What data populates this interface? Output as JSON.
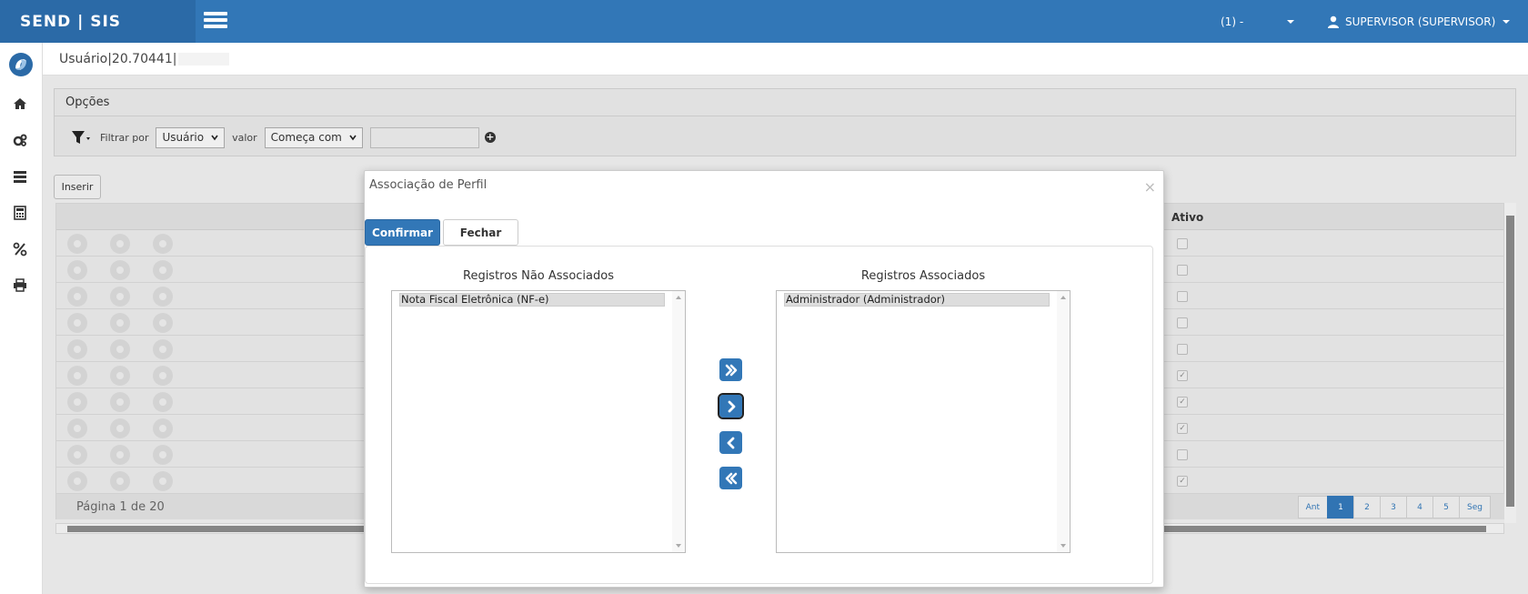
{
  "header": {
    "brand": "SEND | SIS",
    "context": "(1) -",
    "user": "SUPERVISOR (SUPERVISOR)"
  },
  "breadcrumb": {
    "text": "Usuário|20.70441|"
  },
  "options": {
    "title": "Opções",
    "filter_label": "Filtrar por",
    "filter_field": "Usuário",
    "value_label": "valor",
    "value_op": "Começa com",
    "value_input": ""
  },
  "toolbar": {
    "insert_label": "Inserir"
  },
  "grid": {
    "active_header": "Ativo",
    "rows": [
      {
        "active": false
      },
      {
        "active": false
      },
      {
        "active": false
      },
      {
        "active": false
      },
      {
        "active": false
      },
      {
        "active": true
      },
      {
        "active": true
      },
      {
        "active": true
      },
      {
        "active": false
      },
      {
        "active": true
      }
    ],
    "page_info": "Página 1 de 20",
    "pager": [
      "Ant",
      "1",
      "2",
      "3",
      "4",
      "5",
      "Seg"
    ],
    "current_page": "1"
  },
  "modal": {
    "title": "Associação de Perfil",
    "close_symbol": "×",
    "confirm_label": "Confirmar",
    "close_label": "Fechar",
    "left_title": "Registros Não Associados",
    "right_title": "Registros Associados",
    "left_items": [
      "Nota Fiscal Eletrônica (NF-e)"
    ],
    "right_items": [
      "Administrador (Administrador)"
    ]
  },
  "colors": {
    "primary": "#3277b7",
    "brand_bg": "#2b6aa7"
  }
}
